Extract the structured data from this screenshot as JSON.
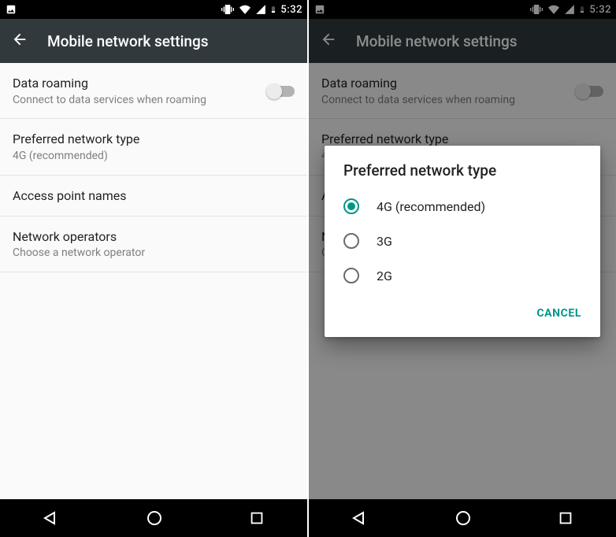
{
  "status": {
    "time": "5:32"
  },
  "appbar": {
    "title": "Mobile network settings"
  },
  "settings": {
    "data_roaming": {
      "title": "Data roaming",
      "subtitle": "Connect to data services when roaming"
    },
    "pref_net": {
      "title": "Preferred network type",
      "subtitle": "4G (recommended)"
    },
    "apn": {
      "title": "Access point names"
    },
    "operators": {
      "title": "Network operators",
      "subtitle": "Choose a network operator"
    }
  },
  "dialog": {
    "title": "Preferred network type",
    "options": {
      "o0": "4G (recommended)",
      "o1": "3G",
      "o2": "2G"
    },
    "cancel": "CANCEL"
  },
  "colors": {
    "accent": "#009688"
  }
}
